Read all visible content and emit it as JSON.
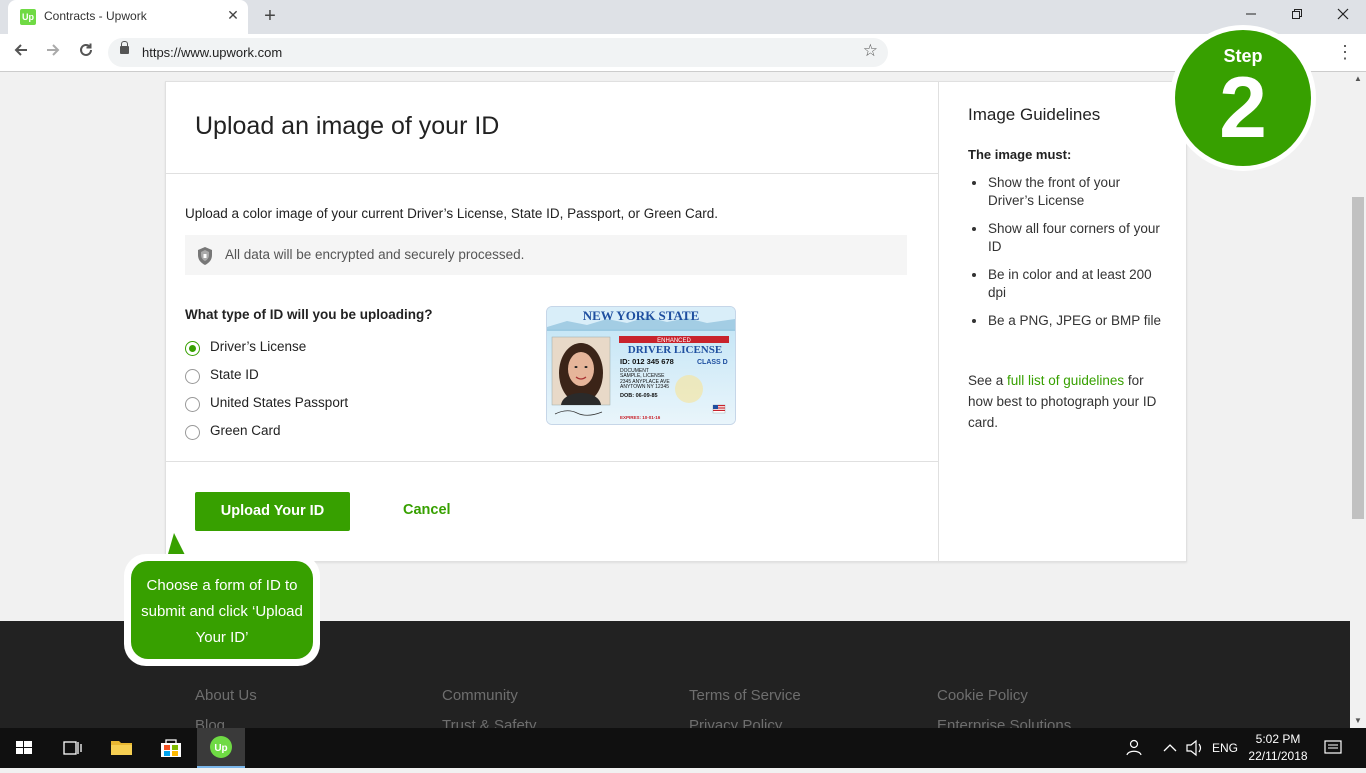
{
  "browser": {
    "tab_title": "Contracts - Upwork",
    "tab_favicon": "Up",
    "url": "https://www.upwork.com",
    "new_tab_symbol": "+",
    "close_symbol": "✕"
  },
  "card": {
    "title": "Upload an image of your ID",
    "intro": "Upload a color image of your current Driver’s License, State ID, Passport, or Green Card.",
    "secure_note": "All data will be encrypted and securely processed.",
    "question": "What type of ID will you be uploading?",
    "id_options": [
      {
        "label": "Driver’s License",
        "selected": true
      },
      {
        "label": "State ID",
        "selected": false
      },
      {
        "label": "United States Passport",
        "selected": false
      },
      {
        "label": "Green Card",
        "selected": false
      }
    ],
    "id_card": {
      "state": "NEW YORK STATE",
      "enhanced": "ENHANCED",
      "type": "DRIVER LICENSE",
      "id_number": "ID: 012 345 678",
      "class": "CLASS D",
      "name_lines": [
        "DOCUMENT",
        "SAMPLE, LICENSE",
        "2345 ANYPLACE AVE",
        "ANYTOWN NY 12345"
      ],
      "dob": "DOB: 06-09-85",
      "expires": "EXPIRES: 10-01-16"
    },
    "upload_button": "Upload Your ID",
    "cancel_button": "Cancel"
  },
  "guidelines": {
    "title": "Image Guidelines",
    "must_label": "The image must:",
    "items": [
      "Show the front of your Driver’s License",
      "Show all four corners of your ID",
      "Be in color and at least 200 dpi",
      "Be a PNG, JPEG or BMP file"
    ],
    "see_prefix": "See a ",
    "see_link": "full list of guidelines",
    "see_suffix": " for how best to photograph your ID card."
  },
  "step_badge": {
    "word": "Step",
    "number": "2"
  },
  "callout": {
    "text": "Choose a form of ID to submit and click ‘Upload Your ID’"
  },
  "footer_links": [
    [
      "About Us",
      "Blog"
    ],
    [
      "Community",
      "Trust & Safety"
    ],
    [
      "Terms of Service",
      "Privacy Policy"
    ],
    [
      "Cookie Policy",
      "Enterprise Solutions"
    ]
  ],
  "taskbar": {
    "language": "ENG",
    "time": "5:02 PM",
    "date": "22/11/2018"
  },
  "colors": {
    "brand_green": "#37a000",
    "footer_dark": "#222222"
  }
}
